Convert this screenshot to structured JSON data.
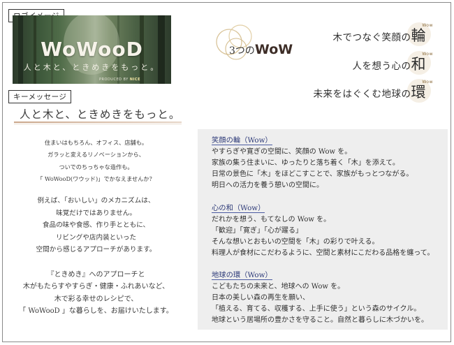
{
  "logo_section": {
    "tag_label": "ロゴイメージ",
    "logo_text": "WoWooD",
    "logo_subtext": "人と木と、ときめきをもっと。",
    "producer_text": "PRODUCED BY",
    "producer_brand": "NICE"
  },
  "message_section": {
    "tag_label": "キーメッセージ",
    "headline": "人と木と、ときめきをもっと。",
    "paragraphs": [
      [
        "住まいはもちろん、オフィス、店舗も。",
        "ガラッと変えるリノベーションから、",
        "ついでのちっちゃな造作も。",
        "「 WoWooD(ワウッド)」でかなえませんか？"
      ],
      [
        "例えば、「おいしい」のメカニズムは、",
        "味覚だけではありません。",
        "食品の味や食感、作り手とともに、",
        "リビングや店内装といった",
        "空間から感じるアプローチがあります。"
      ],
      [
        "『ときめき』へのアプローチと",
        "木がもたらすやすらぎ・健康・ふれあいなど、",
        "木で彩る幸せのレシピで、",
        "「 WoWooD 」な暮らしを、お届けいたします。"
      ]
    ]
  },
  "three_wow": {
    "badge_prefix": "3つの",
    "badge_wow": "WoW",
    "lines": [
      {
        "text": "木でつなぐ笑顔の",
        "kanji": "輪",
        "mini": "Wow"
      },
      {
        "text": "人を想う心の",
        "kanji": "和",
        "mini": "Wow"
      },
      {
        "text": "未来をはぐくむ地球の",
        "kanji": "環",
        "mini": "Wow"
      }
    ]
  },
  "details": [
    {
      "heading": "笑顔の輪（Wow）",
      "lines": [
        "やすらぎや寛ぎの空間に、笑顔の Wow を。",
        "家族の集う住まいに、ゆったりと落ち着く「木」を添えて。",
        "日常の景色に「木」をほどこすことで、家族がもっとつながる。",
        "明日への活力を養う憩いの空間に。"
      ]
    },
    {
      "heading": "心の和（Wow）",
      "lines": [
        "だれかを想う、もてなしの Wow を。",
        "「歓迎」「寛ぎ」「心が躍る」",
        "そんな想いとおもいの空間を「木」の彩りで叶える。",
        "料理人が食材にこだわるように、空間と素材にこだわる品格を纏って。"
      ]
    },
    {
      "heading": "地球の環（Wow）",
      "lines": [
        "こどもたちの未来と、地球への Wow を。",
        "日本の美しい森の再生を願い、",
        "「植える、育てる、収穫する、上手に使う」という森のサイクル。",
        "地球という居場所の豊かさを守ること。自然と暮らしに木づかいを。"
      ]
    }
  ],
  "colors": {
    "heading_blue": "#2d3a78",
    "panel_gray": "#eeeeee",
    "accent_line": "#caa68a"
  }
}
